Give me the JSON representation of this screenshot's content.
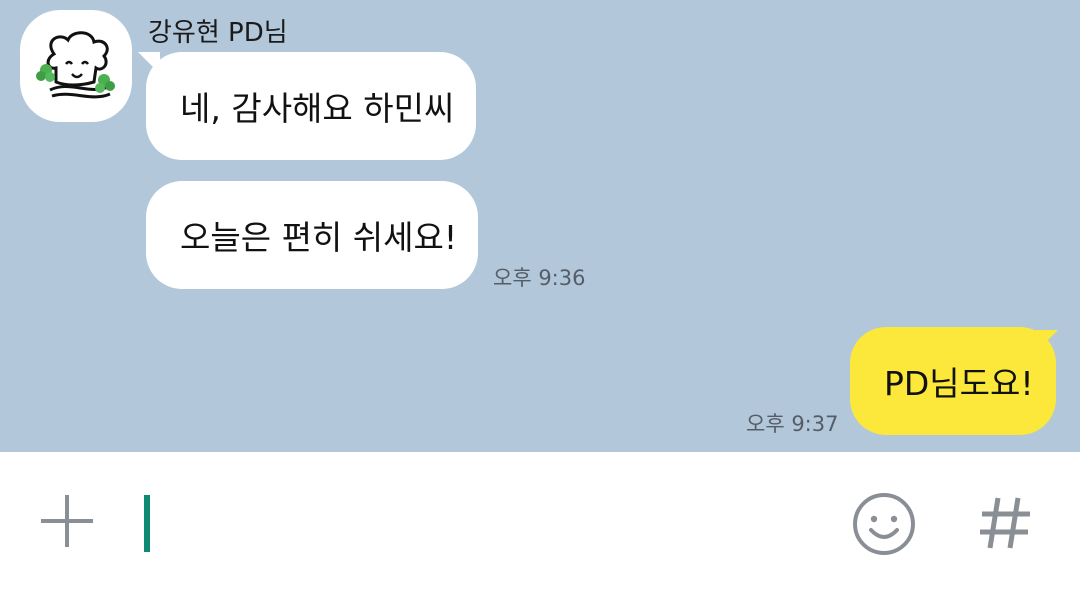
{
  "conversation": {
    "sender_name": "강유현 PD님",
    "messages": [
      {
        "text": "네, 감사해요 하민씨",
        "direction": "incoming"
      },
      {
        "text": "오늘은 편히 쉬세요!",
        "direction": "incoming",
        "time": "오후 9:36"
      },
      {
        "text": "PD님도요!",
        "direction": "outgoing",
        "time": "오후 9:37"
      }
    ]
  },
  "composer": {
    "input_value": "",
    "icons": [
      "plus-icon",
      "emoji-icon",
      "hashtag-icon"
    ]
  },
  "colors": {
    "chat_background": "#b2c7da",
    "incoming_bubble": "#ffffff",
    "outgoing_bubble": "#fbe83a",
    "caret": "#0e8a72",
    "icon_gray": "#8a8f96"
  }
}
